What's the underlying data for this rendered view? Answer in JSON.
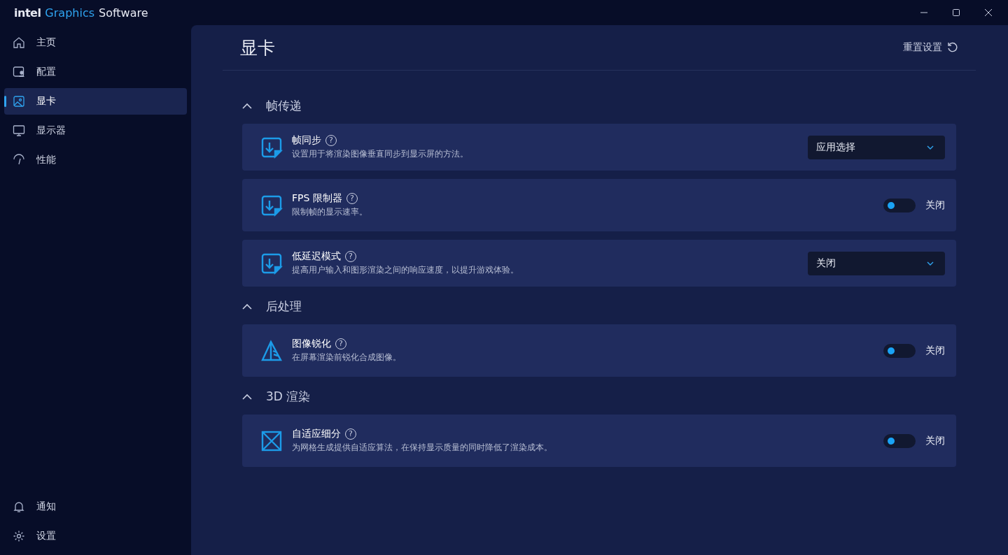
{
  "window": {
    "brand": "intel",
    "title_accent": "Graphics",
    "title": "Software"
  },
  "sidebar": {
    "items": [
      {
        "label": "主页",
        "selected": false
      },
      {
        "label": "配置",
        "selected": false
      },
      {
        "label": "显卡",
        "selected": true
      },
      {
        "label": "显示器",
        "selected": false
      },
      {
        "label": "性能",
        "selected": false
      }
    ],
    "bottom_items": [
      {
        "label": "通知"
      },
      {
        "label": "设置"
      }
    ]
  },
  "page": {
    "title": "显卡",
    "reset_label": "重置设置"
  },
  "sections": [
    {
      "title": "帧传递",
      "expanded": true,
      "items": [
        {
          "kind": "dropdown",
          "title": "帧同步",
          "help": "?",
          "description": "设置用于将渲染图像垂直同步到显示屏的方法。",
          "value": "应用选择"
        },
        {
          "kind": "toggle",
          "title": "FPS 限制器",
          "help": "?",
          "description": "限制帧的显示速率。",
          "on": false,
          "value": "关闭"
        },
        {
          "kind": "dropdown",
          "title": "低延迟模式",
          "help": "?",
          "description": "提高用户输入和图形渲染之间的响应速度，以提升游戏体验。",
          "value": "关闭"
        }
      ]
    },
    {
      "title": "后处理",
      "expanded": true,
      "items": [
        {
          "kind": "toggle",
          "title": "图像锐化",
          "help": "?",
          "description": "在屏幕渲染前锐化合成图像。",
          "on": false,
          "value": "关闭"
        }
      ]
    },
    {
      "title": "3D 渲染",
      "expanded": true,
      "items": [
        {
          "kind": "toggle",
          "title": "自适应细分",
          "help": "?",
          "description": "为网格生成提供自适应算法，在保持显示质量的同时降低了渲染成本。",
          "on": false,
          "value": "关闭"
        }
      ]
    }
  ]
}
